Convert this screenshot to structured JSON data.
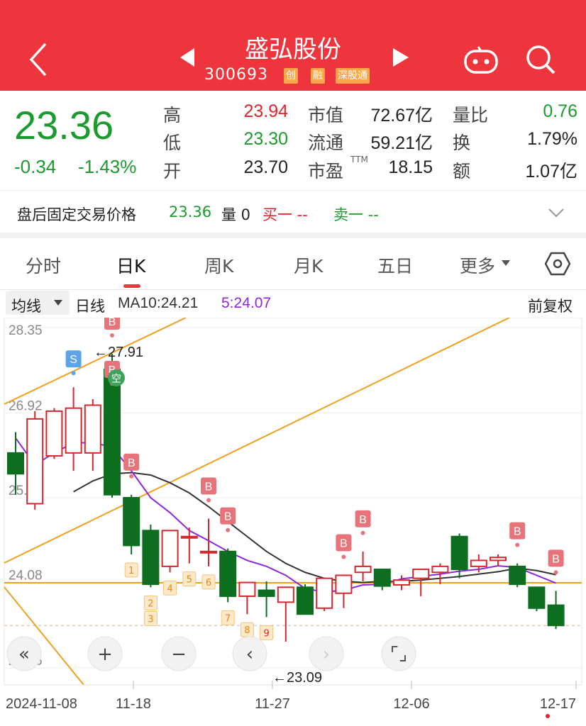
{
  "header": {
    "stock_name": "盛弘股份",
    "code": "300693",
    "tags": [
      "创",
      "融",
      "深股通"
    ]
  },
  "quote": {
    "price": "23.36",
    "change": "-0.34",
    "change_pct": "-1.43%",
    "fields": [
      {
        "label": "高",
        "value": "23.94",
        "color": "red"
      },
      {
        "label": "低",
        "value": "23.30",
        "color": "green"
      },
      {
        "label": "开",
        "value": "23.70",
        "color": "black"
      },
      {
        "label": "市值",
        "value": "72.67亿",
        "color": "black"
      },
      {
        "label": "流通",
        "value": "59.21亿",
        "color": "black"
      },
      {
        "label": "市盈",
        "sup": "TTM",
        "value": "18.15",
        "color": "black"
      },
      {
        "label": "量比",
        "value": "0.76",
        "color": "green"
      },
      {
        "label": "换",
        "value": "1.79%",
        "color": "black"
      },
      {
        "label": "额",
        "value": "1.07亿",
        "color": "black"
      }
    ]
  },
  "after_hours": {
    "label": "盘后固定交易价格",
    "price": "23.36",
    "volume_label": "量 0",
    "buy_label": "买一 --",
    "sell_label": "卖一 --"
  },
  "tabs": [
    "分时",
    "日K",
    "周K",
    "月K",
    "五日",
    "更多"
  ],
  "active_tab": "日K",
  "ma_bar": {
    "selector": "均线",
    "period": "日线",
    "ma10": "MA10:24.21",
    "ma5": "5:24.07",
    "adjust": "前复权"
  },
  "colors": {
    "up": "#d6262e",
    "down": "#0c6e1e",
    "accent": "#ee343c",
    "ma5": "#8e26e0",
    "ma10": "#333333",
    "trend": "#f0a020"
  },
  "chart_data": {
    "type": "candlestick",
    "y_ticks": [
      "28.35",
      "26.92",
      "25.50",
      "24.08",
      "22.65"
    ],
    "x_labels": [
      "2024-11-08",
      "11-18",
      "11-27",
      "12-06",
      "12-17"
    ],
    "annotations": {
      "high": "←27.91",
      "low": "←23.09"
    },
    "candles": [
      {
        "o": 26.25,
        "c": 25.9,
        "h": 26.6,
        "l": 25.55
      },
      {
        "o": 25.4,
        "c": 26.82,
        "h": 26.95,
        "l": 25.3
      },
      {
        "o": 26.2,
        "c": 26.95,
        "h": 27.0,
        "l": 26.15
      },
      {
        "o": 26.25,
        "c": 27.0,
        "h": 27.35,
        "l": 25.95
      },
      {
        "o": 26.25,
        "c": 27.05,
        "h": 27.15,
        "l": 25.95
      },
      {
        "o": 27.65,
        "c": 25.55,
        "h": 27.91,
        "l": 25.5
      },
      {
        "o": 25.5,
        "c": 24.7,
        "h": 25.55,
        "l": 24.55
      },
      {
        "o": 24.95,
        "c": 24.05,
        "h": 25.05,
        "l": 24.0
      },
      {
        "o": 24.35,
        "c": 24.95,
        "h": 24.95,
        "l": 24.25
      },
      {
        "o": 24.85,
        "c": 24.85,
        "h": 25.0,
        "l": 24.4
      },
      {
        "o": 24.6,
        "c": 24.6,
        "h": 25.15,
        "l": 24.35
      },
      {
        "o": 24.6,
        "c": 23.85,
        "h": 24.65,
        "l": 23.75
      },
      {
        "o": 23.85,
        "c": 24.08,
        "h": 24.08,
        "l": 23.55
      },
      {
        "o": 23.95,
        "c": 23.85,
        "h": 24.1,
        "l": 23.5
      },
      {
        "o": 23.75,
        "c": 24.0,
        "h": 24.0,
        "l": 23.09
      },
      {
        "o": 24.0,
        "c": 23.55,
        "h": 24.05,
        "l": 23.55
      },
      {
        "o": 23.65,
        "c": 24.15,
        "h": 24.15,
        "l": 23.6
      },
      {
        "o": 23.9,
        "c": 24.2,
        "h": 24.2,
        "l": 23.65
      },
      {
        "o": 24.25,
        "c": 24.35,
        "h": 24.6,
        "l": 24.1
      },
      {
        "o": 24.3,
        "c": 24.02,
        "h": 24.3,
        "l": 23.95
      },
      {
        "o": 24.04,
        "c": 24.12,
        "h": 24.2,
        "l": 23.95
      },
      {
        "o": 24.15,
        "c": 24.3,
        "h": 24.3,
        "l": 23.85
      },
      {
        "o": 24.25,
        "c": 24.35,
        "h": 24.4,
        "l": 24.05
      },
      {
        "o": 24.85,
        "c": 24.3,
        "h": 24.9,
        "l": 24.15
      },
      {
        "o": 24.35,
        "c": 24.45,
        "h": 24.55,
        "l": 24.25
      },
      {
        "o": 24.45,
        "c": 24.5,
        "h": 24.55,
        "l": 24.35
      },
      {
        "o": 24.35,
        "c": 24.05,
        "h": 24.4,
        "l": 24.0
      },
      {
        "o": 24.0,
        "c": 23.65,
        "h": 24.0,
        "l": 23.6
      },
      {
        "o": 23.7,
        "c": 23.36,
        "h": 23.94,
        "l": 23.3
      }
    ],
    "ma5": [
      26.5,
      26.05,
      26.25,
      26.42,
      26.42,
      26.35,
      25.95,
      25.5,
      25.25,
      24.95,
      24.78,
      24.6,
      24.45,
      24.35,
      24.2,
      23.98,
      23.92,
      23.95,
      24.04,
      24.05,
      24.14,
      24.18,
      24.22,
      24.27,
      24.3,
      24.36,
      24.33,
      24.2,
      24.07
    ],
    "ma10": [
      null,
      null,
      null,
      25.6,
      25.78,
      25.9,
      25.92,
      25.88,
      25.75,
      25.58,
      25.35,
      25.1,
      24.85,
      24.6,
      24.4,
      24.25,
      24.15,
      24.1,
      24.08,
      24.1,
      24.1,
      24.12,
      24.15,
      24.18,
      24.22,
      24.26,
      24.32,
      24.28,
      24.21
    ],
    "signals": [
      {
        "i": 3,
        "label": "S",
        "type": "sell"
      },
      {
        "i": 5,
        "label": "B",
        "type": "buy"
      },
      {
        "i": 5,
        "label": "B",
        "type": "buy"
      },
      {
        "i": 6,
        "label": "B",
        "type": "buy"
      },
      {
        "i": 10,
        "label": "B",
        "type": "buy"
      },
      {
        "i": 11,
        "label": "B",
        "type": "buy"
      },
      {
        "i": 17,
        "label": "B",
        "type": "buy"
      },
      {
        "i": 18,
        "label": "B",
        "type": "buy"
      },
      {
        "i": 26,
        "label": "B",
        "type": "buy"
      },
      {
        "i": 28,
        "label": "B",
        "type": "buy"
      }
    ],
    "numbered": [
      {
        "i": 6,
        "label": "1"
      },
      {
        "i": 7,
        "label": "2"
      },
      {
        "i": 7,
        "label": "3"
      },
      {
        "i": 8,
        "label": "4"
      },
      {
        "i": 9,
        "label": "5"
      },
      {
        "i": 10,
        "label": "6"
      },
      {
        "i": 11,
        "label": "7"
      },
      {
        "i": 12,
        "label": "8"
      },
      {
        "i": 13,
        "label": "9"
      }
    ],
    "hold_marker": {
      "i": 5,
      "label": "空"
    }
  },
  "controls": [
    "«",
    "+",
    "−",
    "‹",
    "›",
    "⌜⌟"
  ]
}
